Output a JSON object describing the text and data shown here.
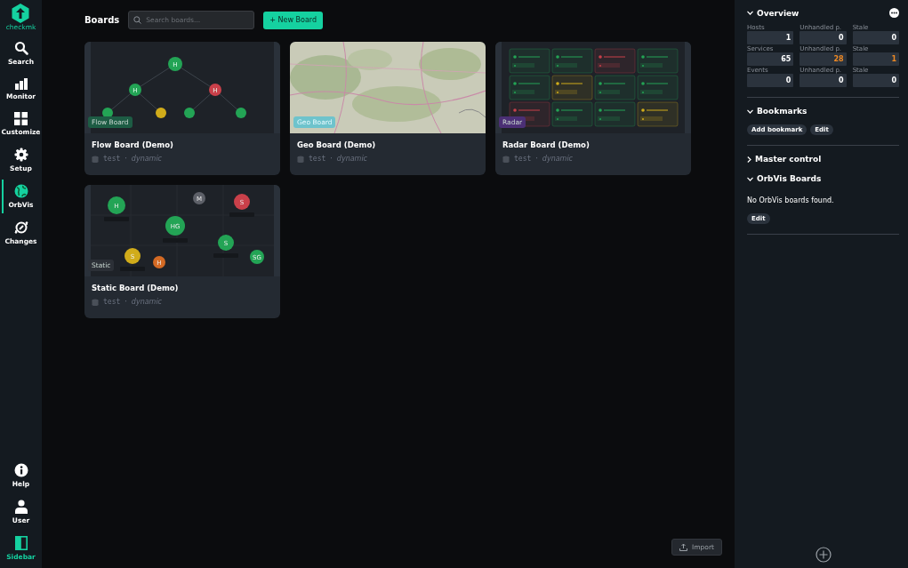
{
  "nav": {
    "logo": "checkmk",
    "items": [
      {
        "label": "Search",
        "selected": false
      },
      {
        "label": "Monitor",
        "selected": false
      },
      {
        "label": "Customize",
        "selected": false
      },
      {
        "label": "Setup",
        "selected": false
      },
      {
        "label": "OrbVis",
        "selected": true
      },
      {
        "label": "Changes",
        "selected": false
      }
    ],
    "bottom_items": [
      {
        "label": "Help",
        "on": false
      },
      {
        "label": "User",
        "on": false
      },
      {
        "label": "Sidebar",
        "on": true
      }
    ]
  },
  "header": {
    "title": "Boards",
    "search": {
      "placeholder": "Search boards..."
    },
    "new_button": "+ New Board"
  },
  "boards": [
    {
      "title": "Flow Board (Demo)",
      "badge": "Flow Board",
      "color": "#1d5c44",
      "kind": "flow",
      "owner": "test",
      "separator": "·",
      "mode": "dynamic",
      "nodes": [
        {
          "text": "H",
          "color": "#23a455"
        },
        {
          "text": "H",
          "color": "#23a455"
        },
        {
          "text": "H",
          "color": "#c9404a"
        },
        {
          "color": "#23a455"
        },
        {
          "color": "#d1ac1a"
        },
        {
          "color": "#23a455"
        },
        {
          "color": "#23a455"
        }
      ]
    },
    {
      "title": "Geo Board (Demo)",
      "badge": "Geo Board",
      "color": "#6ec3cc",
      "kind": "map",
      "owner": "test",
      "separator": "·",
      "mode": "dynamic"
    },
    {
      "title": "Radar Board (Demo)",
      "badge": "Radar",
      "color": "#4b2f75",
      "kind": "radar",
      "owner": "test",
      "separator": "·",
      "mode": "dynamic",
      "tiles": [
        {
          "color": "#23a455"
        },
        {
          "color": "#23a455"
        },
        {
          "color": "#c9404a"
        },
        {
          "color": "#23a455"
        },
        {
          "color": "#23a455"
        },
        {
          "color": "#d1ac1a"
        },
        {
          "color": "#23a455"
        },
        {
          "color": "#23a455"
        },
        {
          "color": "#c9404a"
        },
        {
          "color": "#23a455"
        },
        {
          "color": "#23a455"
        },
        {
          "color": "#d1ac1a"
        }
      ]
    },
    {
      "title": "Static Board (Demo)",
      "badge": "Static",
      "color": "#2c3037",
      "kind": "static",
      "owner": "test",
      "separator": "·",
      "mode": "dynamic",
      "nodes": [
        {
          "text": "H",
          "color": "#23a455"
        },
        {
          "text": "M",
          "color": "#5d6068"
        },
        {
          "text": "S",
          "color": "#c9404a"
        },
        {
          "text": "HG",
          "color": "#23a455"
        },
        {
          "text": "S",
          "color": "#23a455"
        },
        {
          "text": "S",
          "color": "#d1ac1a"
        },
        {
          "text": "H",
          "color": "#d46a24"
        },
        {
          "text": "SG",
          "color": "#23a455"
        }
      ]
    }
  ],
  "import_button": "Import",
  "sidebar": {
    "sections": [
      {
        "kind": "overview",
        "title": "Overview",
        "expanded": true,
        "rows": [
          [
            {
              "label": "Hosts",
              "value": "1",
              "alert": false
            },
            {
              "label": "Unhandled p.",
              "value": "0",
              "alert": false
            },
            {
              "label": "Stale",
              "value": "0",
              "alert": false
            }
          ],
          [
            {
              "label": "Services",
              "value": "65",
              "alert": false
            },
            {
              "label": "Unhandled p.",
              "value": "28",
              "alert": true
            },
            {
              "label": "Stale",
              "value": "1",
              "alert": true
            }
          ],
          [
            {
              "label": "Events",
              "value": "0",
              "alert": false
            },
            {
              "label": "Unhandled p.",
              "value": "0",
              "alert": false
            },
            {
              "label": "Stale",
              "value": "0",
              "alert": false
            }
          ]
        ]
      },
      {
        "kind": "buttons",
        "title": "Bookmarks",
        "expanded": true,
        "buttons": [
          "Add bookmark",
          "Edit"
        ]
      },
      {
        "kind": "empty",
        "title": "Master control",
        "expanded": false
      },
      {
        "kind": "text",
        "title": "OrbVis Boards",
        "expanded": true,
        "text": "No OrbVis boards found.",
        "buttons": [
          "Edit"
        ]
      }
    ]
  }
}
